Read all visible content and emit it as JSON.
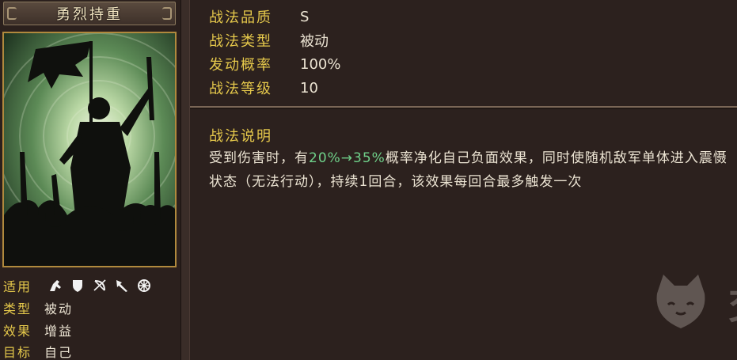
{
  "skill": {
    "name": "勇烈持重",
    "stats": [
      {
        "key": "战法品质",
        "value": "S"
      },
      {
        "key": "战法类型",
        "value": "被动"
      },
      {
        "key": "发动概率",
        "value": "100%"
      },
      {
        "key": "战法等级",
        "value": "10"
      }
    ],
    "description_title": "战法说明",
    "description": {
      "before": "受到伤害时，有",
      "highlight": "20%→35%",
      "after": "概率净化自己负面效果，同时使随机敌军单体进入震慑状态（无法行动），持续1回合，该效果每回合最多触发一次"
    },
    "highlight_color": "#6fd18a"
  },
  "attributes": {
    "applicable_label": "适用",
    "applicable_icons": [
      "cavalry-icon",
      "shield-icon",
      "bow-icon",
      "spear-icon",
      "wheel-icon"
    ],
    "type_label": "类型",
    "type_value": "被动",
    "effect_label": "效果",
    "effect_value": "增益",
    "target_label": "目标",
    "target_value": "自己"
  },
  "watermark": {
    "text": "交易猫"
  },
  "colors": {
    "label": "#e5c84b",
    "text": "#ece4d3",
    "portrait_border": "#b0893d"
  }
}
